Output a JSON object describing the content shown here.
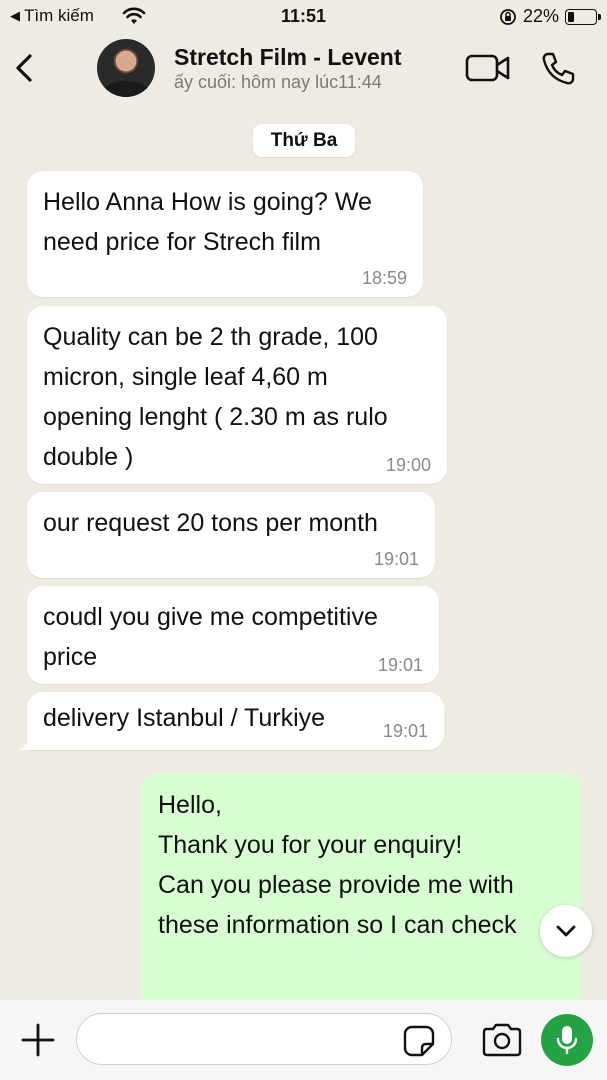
{
  "status_bar": {
    "back_app": "Tìm kiếm",
    "time": "11:51",
    "battery": "22%",
    "battery_level": 0.22
  },
  "header": {
    "contact_name": "Stretch Film - Levent",
    "last_seen": "ấy cuối: hôm nay lúc11:44"
  },
  "date_divider": "Thứ Ba",
  "incoming_messages": [
    {
      "text": "Hello Anna How is going? We\nneed price for Strech film",
      "time": "18:59"
    },
    {
      "text": "Quality can be 2 th grade, 100\nmicron, single leaf 4,60 m\nopening lenght ( 2.30 m as rulo\ndouble )",
      "time": "19:00"
    },
    {
      "text": "our request 20 tons per month",
      "time": "19:01"
    },
    {
      "text": "coudl you give me competitive\nprice",
      "time": "19:01"
    },
    {
      "text": "delivery Istanbul / Turkiye",
      "time": "19:01"
    }
  ],
  "outgoing_message": {
    "lines": [
      "Hello,",
      "",
      "Thank you for your enquiry!",
      "",
      "Can you please provide me with",
      "these information so I can check"
    ]
  },
  "composer": {
    "value": "",
    "placeholder": ""
  },
  "icons": [
    "back-chevron-icon",
    "wifi-icon",
    "orientation-lock-icon",
    "battery-icon",
    "video-call-icon",
    "phone-call-icon",
    "chevron-down-icon",
    "plus-icon",
    "sticker-icon",
    "camera-icon",
    "microphone-icon"
  ],
  "colors": {
    "background": "#efeae2",
    "incoming_bubble": "#ffffff",
    "outgoing_bubble": "#d9fdd3",
    "mic_button": "#25a244"
  }
}
